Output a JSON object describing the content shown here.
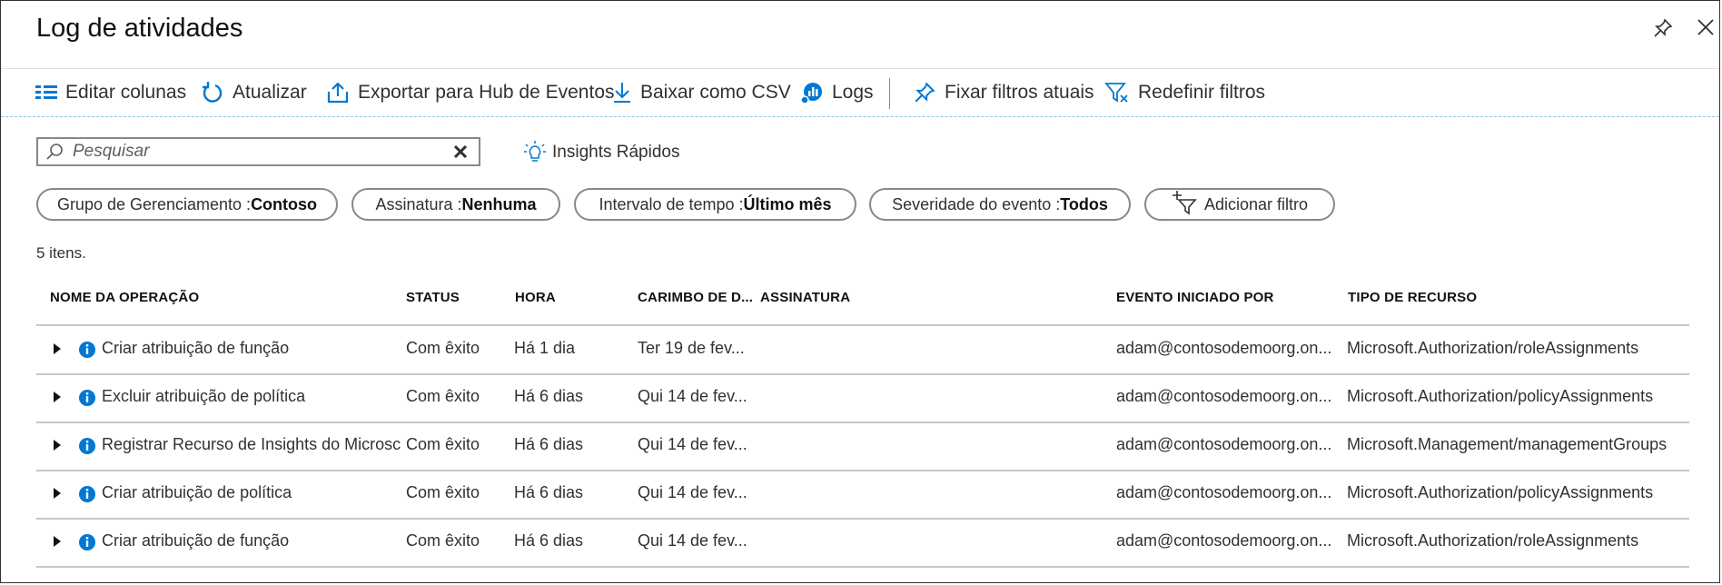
{
  "window": {
    "title": "Log de atividades",
    "pin_icon": "pin-icon",
    "close_icon": "close-icon"
  },
  "toolbar": {
    "edit_columns": "Editar colunas",
    "refresh": "Atualizar",
    "export": "Exportar para Hub de Eventos",
    "download_csv": "Baixar como CSV",
    "logs": "Logs",
    "pin_filters": "Fixar filtros atuais",
    "reset_filters": "Redefinir filtros"
  },
  "search": {
    "placeholder": "Pesquisar",
    "value": ""
  },
  "quick_insights": "Insights Rápidos",
  "filters": [
    {
      "label": "Grupo de Gerenciamento : ",
      "value": "Contoso"
    },
    {
      "label": "Assinatura : ",
      "value": "Nenhuma"
    },
    {
      "label": "Intervalo de tempo : ",
      "value": "Último mês"
    },
    {
      "label": "Severidade do evento : ",
      "value": "Todos"
    }
  ],
  "add_filter": "Adicionar filtro",
  "item_count": "5 itens.",
  "columns": {
    "operation": "NOME DA OPERAÇÃO",
    "status": "STATUS",
    "time": "HORA",
    "timestamp": "CARIMBO DE D...",
    "subscription": "ASSINATURA",
    "initiated_by": "EVENTO INICIADO POR",
    "resource_type": "TIPO DE RECURSO"
  },
  "rows": [
    {
      "operation": "Criar atribuição de função",
      "status": "Com êxito",
      "time": "Há 1 dia",
      "timestamp": "Ter 19 de fev...",
      "subscription": "",
      "initiated_by": "adam@contosodemoorg.on...",
      "resource_type": "Microsoft.Authorization/roleAssignments"
    },
    {
      "operation": "Excluir atribuição de política",
      "status": "Com êxito",
      "time": "Há 6 dias",
      "timestamp": "Qui 14 de fev...",
      "subscription": "",
      "initiated_by": "adam@contosodemoorg.on...",
      "resource_type": "Microsoft.Authorization/policyAssignments"
    },
    {
      "operation": "Registrar Recurso de Insights do Microsc",
      "status": "Com êxito",
      "time": "Há 6 dias",
      "timestamp": "Qui 14 de fev...",
      "subscription": "",
      "initiated_by": "adam@contosodemoorg.on...",
      "resource_type": "Microsoft.Management/managementGroups"
    },
    {
      "operation": "Criar atribuição de política",
      "status": "Com êxito",
      "time": "Há 6 dias",
      "timestamp": "Qui 14 de fev...",
      "subscription": "",
      "initiated_by": "adam@contosodemoorg.on...",
      "resource_type": "Microsoft.Authorization/policyAssignments"
    },
    {
      "operation": "Criar atribuição de função",
      "status": "Com êxito",
      "time": "Há 6 dias",
      "timestamp": "Qui 14 de fev...",
      "subscription": "",
      "initiated_by": "adam@contosodemoorg.on...",
      "resource_type": "Microsoft.Authorization/roleAssignments"
    }
  ],
  "colors": {
    "accent": "#0078d4",
    "text": "#323130",
    "border": "#8a8886",
    "divider": "#c8c6c4"
  }
}
